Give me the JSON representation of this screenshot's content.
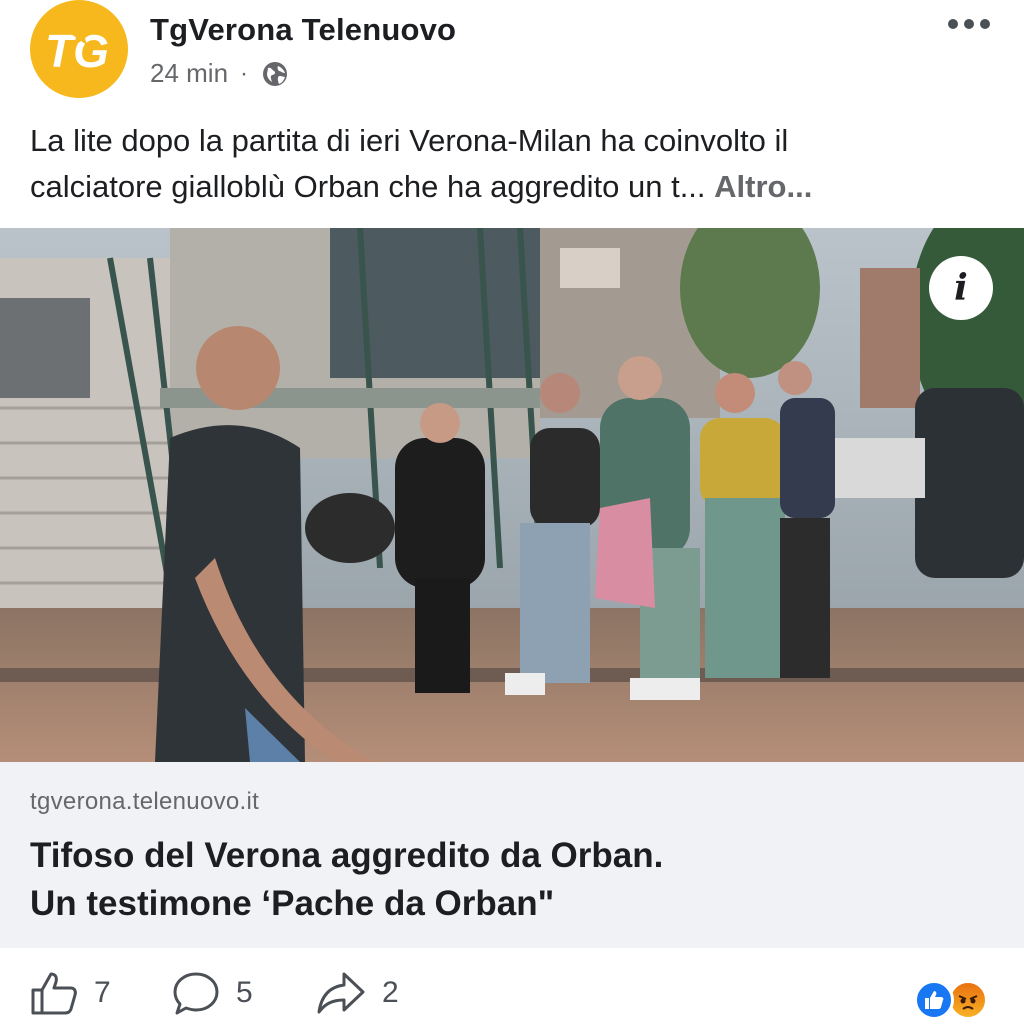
{
  "post": {
    "page_name": "TgVerona Telenuovo",
    "avatar_text": "TG",
    "time": "24 min",
    "separator": "·",
    "text_line1": "La lite dopo la partita di ieri Verona-Milan ha coinvolto il",
    "text_line2": "calciatore gialloblù Orban che ha aggredito un t...",
    "more_label": "Altro..."
  },
  "link": {
    "domain": "tgverona.telenuovo.it",
    "title_line1": "Tifoso del Verona aggredito da Orban.",
    "title_line2": "Un testimone ‘Pache da Orban\""
  },
  "actions": {
    "likes": "7",
    "comments": "5",
    "shares": "2"
  },
  "icons": {
    "avatar": "tg-logo-icon",
    "audience": "globe-icon",
    "menu": "more-options-icon",
    "info": "info-icon",
    "like": "thumbs-up-icon",
    "comment": "comment-icon",
    "share": "share-icon",
    "reactions": [
      "like-reaction-icon",
      "angry-reaction-icon"
    ]
  },
  "colors": {
    "brand_yellow": "#f6b81c",
    "like_blue": "#1877f2",
    "link_bg": "#f0f2f5",
    "secondary_text": "#65676b"
  }
}
